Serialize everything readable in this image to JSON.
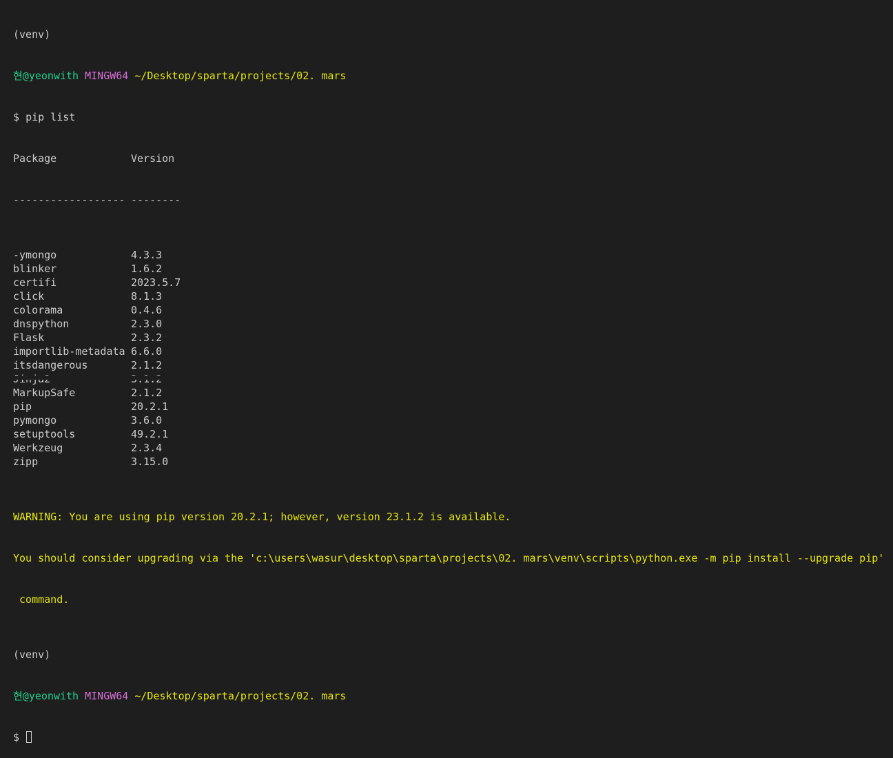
{
  "venv_label": "(venv)",
  "prompt": {
    "user": "현@yeonwith",
    "system": "MINGW64",
    "path": "~/Desktop/sparta/projects/02. mars",
    "symbol": "$"
  },
  "command": "pip list",
  "table": {
    "headers": [
      "Package",
      "Version"
    ],
    "separator": [
      "------------------",
      "--------"
    ],
    "rows": [
      [
        "-ymongo",
        "4.3.3"
      ],
      [
        "blinker",
        "1.6.2"
      ],
      [
        "certifi",
        "2023.5.7"
      ],
      [
        "click",
        "8.1.3"
      ],
      [
        "colorama",
        "0.4.6"
      ],
      [
        "dnspython",
        "2.3.0"
      ],
      [
        "Flask",
        "2.3.2"
      ],
      [
        "importlib-metadata",
        "6.6.0"
      ],
      [
        "itsdangerous",
        "2.1.2"
      ],
      [
        "Jinja2",
        "3.1.2"
      ],
      [
        "MarkupSafe",
        "2.1.2"
      ],
      [
        "pip",
        "20.2.1"
      ],
      [
        "pymongo",
        "3.6.0"
      ],
      [
        "setuptools",
        "49.2.1"
      ],
      [
        "Werkzeug",
        "2.3.4"
      ],
      [
        "zipp",
        "3.15.0"
      ]
    ]
  },
  "warning": [
    "WARNING: You are using pip version 20.2.1; however, version 23.1.2 is available.",
    "You should consider upgrading via the 'c:\\users\\wasur\\desktop\\sparta\\projects\\02. mars\\venv\\scripts\\python.exe -m pip install --upgrade pip'",
    " command."
  ],
  "colors": {
    "background": "#1e1e1e",
    "text": "#cccccc",
    "user": "#23d18b",
    "system": "#d670d6",
    "path": "#e5e510",
    "warning": "#e5e510"
  }
}
